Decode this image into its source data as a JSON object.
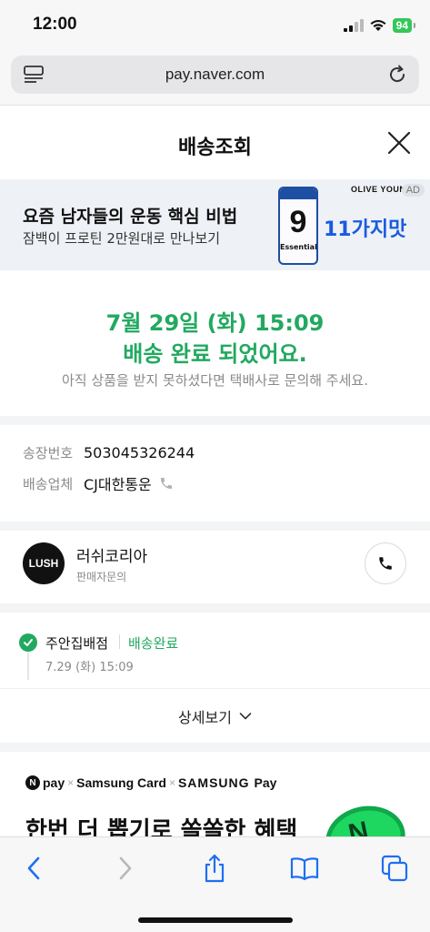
{
  "status_bar": {
    "time": "12:00",
    "battery": "94"
  },
  "browser": {
    "url": "pay.naver.com"
  },
  "header": {
    "title": "배송조회"
  },
  "ad": {
    "title": "요즘 남자들의 운동 핵심 비법",
    "subtitle": "잠백이 프로틴 2만원대로 만나보기",
    "brand": "OLIVE YOUNG",
    "badge": "AD",
    "tagline": "11가지맛",
    "product_number": "9",
    "product_label": "Essential"
  },
  "delivery_status": {
    "date": "7월 29일 (화) 15:09",
    "message": "배송 완료 되었어요.",
    "hint": "아직 상품을 받지 못하셨다면 택배사로 문의해 주세요."
  },
  "tracking": {
    "number_label": "송장번호",
    "number_value": "503045326244",
    "carrier_label": "배송업체",
    "carrier_value": "CJ대한통운"
  },
  "seller": {
    "logo_text": "LUSH",
    "name": "러쉬코리아",
    "sub": "판매자문의"
  },
  "timeline": [
    {
      "place": "주안집배점",
      "status": "배송완료",
      "time": "7.29 (화) 15:09"
    }
  ],
  "more": {
    "label": "상세보기"
  },
  "promo": {
    "pay_label": "pay",
    "card_label": "Samsung Card",
    "samsung_label": "SAMSUNG",
    "samsung_pay_label": "Pay",
    "headline": "한번 더 뽑기로 쏠쏠한 혜택"
  },
  "colors": {
    "accent_green": "#22a960",
    "ad_blue": "#1a5be0",
    "ios_blue": "#007aff"
  }
}
